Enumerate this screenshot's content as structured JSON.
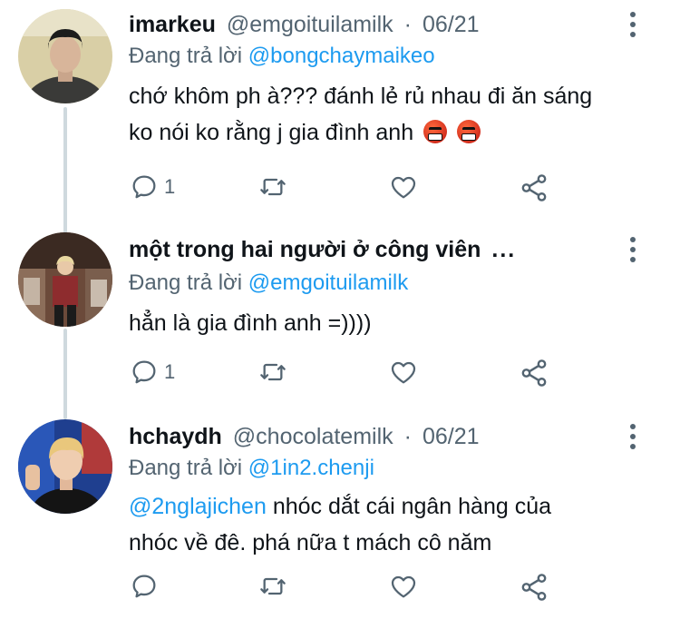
{
  "tweets": [
    {
      "display_name": "imarkeu",
      "handle": "@emgoituilamilk",
      "separator": "·",
      "date": "06/21",
      "replying_prefix": "Đang trả lời",
      "replying_to": "@bongchaymaikeo",
      "text_line1": "chớ khôm ph à??? đánh lẻ rủ nhau đi ăn sáng",
      "text_line2": "ko nói ko rằng j gia đình anh",
      "reply_count": "1",
      "emoji": [
        "angry-face-with-symbols",
        "angry-face-with-symbols"
      ]
    },
    {
      "display_name": "một trong hai người ở công viên",
      "display_name_more": "...",
      "replying_prefix": "Đang trả lời",
      "replying_to": "@emgoituilamilk",
      "text_line1": "hẳn là gia đình anh =))))",
      "reply_count": "1"
    },
    {
      "display_name": "hchaydh",
      "handle": "@chocolatemilk",
      "separator": "·",
      "date": "06/21",
      "replying_prefix": "Đang trả lời",
      "replying_to": "@1in2.chenji",
      "mention_in_text": "@2nglajichen",
      "text_line1_rest": "nhóc dắt cái ngân hàng của",
      "text_line2": "nhóc về đê. phá nữa t mách cô năm",
      "reply_count": ""
    }
  ],
  "colors": {
    "text": "#0f1419",
    "secondary": "#536471",
    "link": "#1d9bf0",
    "thread_line": "#cfd9de"
  },
  "icons": [
    "reply-icon",
    "retweet-icon",
    "like-icon",
    "share-icon",
    "more-options-icon"
  ]
}
